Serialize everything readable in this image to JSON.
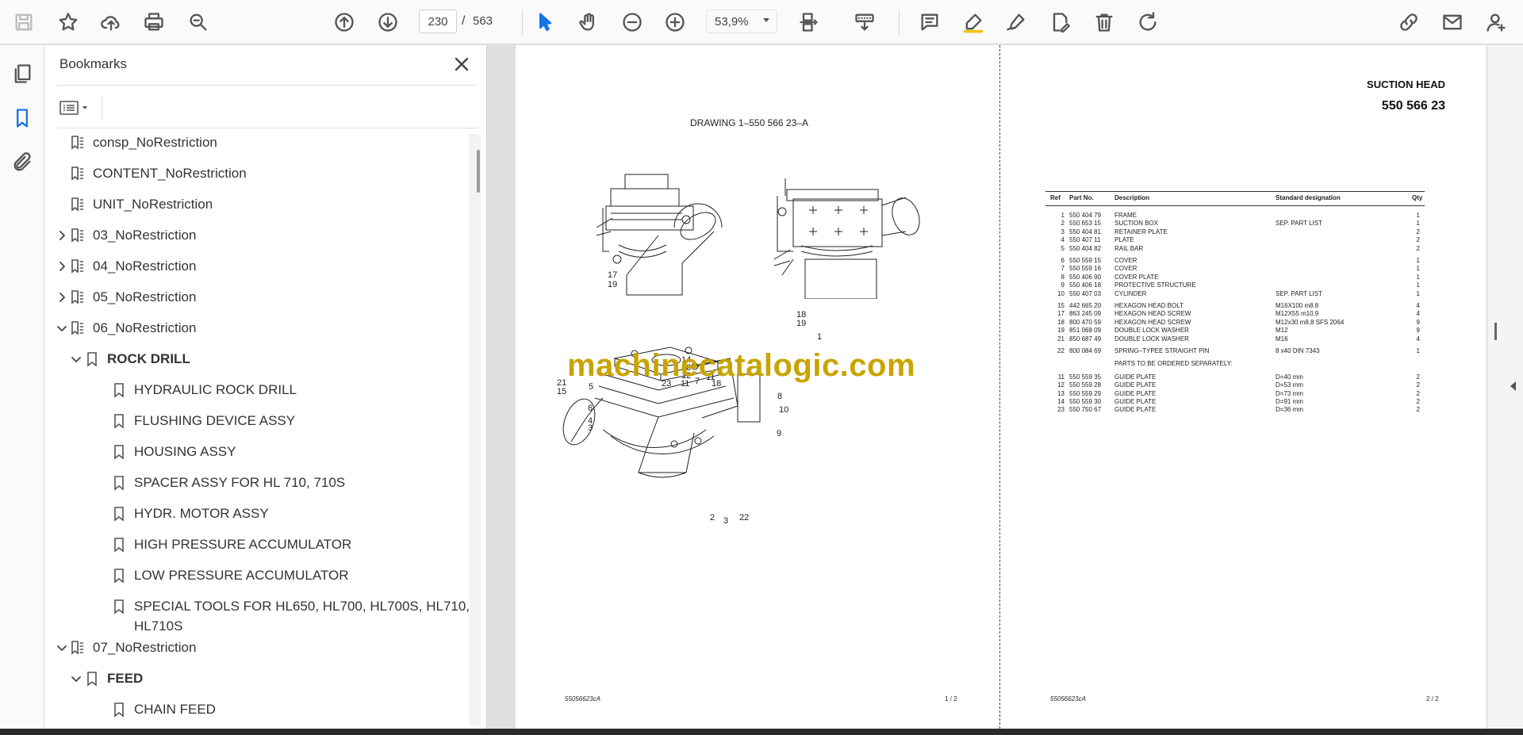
{
  "toolbar": {
    "page_current": "230",
    "page_separator": "/",
    "page_total": "563",
    "zoom": "53,9%"
  },
  "bookmarks_panel": {
    "title": "Bookmarks",
    "items": [
      {
        "label": "consp_NoRestriction",
        "level": 0,
        "expander": "none",
        "icon": "tagged-bookmark-icon"
      },
      {
        "label": "CONTENT_NoRestriction",
        "level": 0,
        "expander": "none",
        "icon": "tagged-bookmark-icon"
      },
      {
        "label": "UNIT_NoRestriction",
        "level": 0,
        "expander": "none",
        "icon": "tagged-bookmark-icon"
      },
      {
        "label": "03_NoRestriction",
        "level": 0,
        "expander": "collapsed",
        "icon": "tagged-bookmark-icon"
      },
      {
        "label": "04_NoRestriction",
        "level": 0,
        "expander": "collapsed",
        "icon": "tagged-bookmark-icon"
      },
      {
        "label": "05_NoRestriction",
        "level": 0,
        "expander": "collapsed",
        "icon": "tagged-bookmark-icon"
      },
      {
        "label": "06_NoRestriction",
        "level": 0,
        "expander": "expanded",
        "icon": "tagged-bookmark-icon"
      },
      {
        "label": "ROCK DRILL",
        "level": 1,
        "expander": "expanded",
        "icon": "bookmark-icon",
        "bold": true
      },
      {
        "label": "HYDRAULIC ROCK DRILL",
        "level": 2,
        "expander": "none",
        "icon": "bookmark-icon"
      },
      {
        "label": "FLUSHING DEVICE ASSY",
        "level": 2,
        "expander": "none",
        "icon": "bookmark-icon"
      },
      {
        "label": "HOUSING ASSY",
        "level": 2,
        "expander": "none",
        "icon": "bookmark-icon"
      },
      {
        "label": "SPACER ASSY FOR HL 710, 710S",
        "level": 2,
        "expander": "none",
        "icon": "bookmark-icon"
      },
      {
        "label": "HYDR. MOTOR ASSY",
        "level": 2,
        "expander": "none",
        "icon": "bookmark-icon"
      },
      {
        "label": "HIGH PRESSURE ACCUMULATOR",
        "level": 2,
        "expander": "none",
        "icon": "bookmark-icon"
      },
      {
        "label": "LOW PRESSURE ACCUMULATOR",
        "level": 2,
        "expander": "none",
        "icon": "bookmark-icon"
      },
      {
        "label": "SPECIAL TOOLS FOR HL650, HL700, HL700S, HL710,",
        "label2": "HL710S",
        "level": 2,
        "expander": "none",
        "icon": "bookmark-icon"
      },
      {
        "label": "07_NoRestriction",
        "level": 0,
        "expander": "expanded",
        "icon": "tagged-bookmark-icon"
      },
      {
        "label": "FEED",
        "level": 1,
        "expander": "expanded",
        "icon": "bookmark-icon",
        "bold": true
      },
      {
        "label": "CHAIN FEED",
        "level": 2,
        "expander": "none",
        "icon": "bookmark-icon"
      }
    ]
  },
  "document": {
    "left_page": {
      "drawing_title": "DRAWING  1–550 566 23–A",
      "footer_code": "55056623cA",
      "footer_page": "1 /  2",
      "callouts": [
        "17",
        "19",
        "18",
        "19",
        "1",
        "14",
        "13",
        "12",
        "7",
        "11",
        "21",
        "5",
        "15",
        "23",
        "11",
        "18",
        "6",
        "4",
        "3",
        "8",
        "10",
        "9",
        "2",
        "3",
        "22"
      ]
    },
    "right_page": {
      "title": "SUCTION HEAD",
      "number": "550 566 23",
      "footer_code": "55056623cA",
      "footer_page": "2 /  2",
      "table": {
        "headers": {
          "ref": "Ref",
          "part": "Part No.",
          "desc": "Description",
          "std": "Standard designation",
          "qty": "Qty"
        },
        "rows": [
          {
            "ref": "1",
            "part": "550 404 79",
            "desc": "FRAME",
            "std": "",
            "qty": "1"
          },
          {
            "ref": "2",
            "part": "550 653 15",
            "desc": "SUCTION BOX",
            "std": "SEP. PART LIST",
            "qty": "1"
          },
          {
            "ref": "3",
            "part": "550 404 81",
            "desc": "RETAINER PLATE",
            "std": "",
            "qty": "2"
          },
          {
            "ref": "4",
            "part": "550 407 11",
            "desc": "PLATE",
            "std": "",
            "qty": "2"
          },
          {
            "ref": "5",
            "part": "550 404 82",
            "desc": "RAIL BAR",
            "std": "",
            "qty": "2"
          },
          {
            "ref": "6",
            "part": "550 559 15",
            "desc": "COVER",
            "std": "",
            "qty": "1"
          },
          {
            "ref": "7",
            "part": "550 559 16",
            "desc": "COVER",
            "std": "",
            "qty": "1"
          },
          {
            "ref": "8",
            "part": "550 406 90",
            "desc": "COVER PLATE",
            "std": "",
            "qty": "1"
          },
          {
            "ref": "9",
            "part": "550 406 18",
            "desc": "PROTECTIVE STRUCTURE",
            "std": "",
            "qty": "1"
          },
          {
            "ref": "10",
            "part": "550 407 03",
            "desc": "CYLINDER",
            "std": "SEP. PART LIST",
            "qty": "1"
          },
          {
            "ref": "15",
            "part": "442 665 20",
            "desc": "HEXAGON HEAD BOLT",
            "std": "M16X100 m8.8",
            "qty": "4"
          },
          {
            "ref": "17",
            "part": "863 245 09",
            "desc": "HEXAGON HEAD SCREW",
            "std": "M12X55 m10,9",
            "qty": "4"
          },
          {
            "ref": "18",
            "part": "800 470 59",
            "desc": "HEXAGON HEAD SCREW",
            "std": "M12x30 m8,8 SFS 2064",
            "qty": "9"
          },
          {
            "ref": "19",
            "part": "851 068 09",
            "desc": "DOUBLE LOCK WASHER",
            "std": "M12",
            "qty": "9"
          },
          {
            "ref": "21",
            "part": "850 687 49",
            "desc": "DOUBLE LOCK WASHER",
            "std": "M16",
            "qty": "4"
          },
          {
            "ref": "22",
            "part": "800 084 69",
            "desc": "SPRING–TYPEE STRAIGHT PIN",
            "std": "8 x40 DIN 7343",
            "qty": "1"
          },
          {
            "ref": "",
            "part": "",
            "desc": "PARTS TO BE ORDERED SEPARATELY:",
            "std": "",
            "qty": ""
          },
          {
            "ref": "11",
            "part": "550 559 35",
            "desc": "GUIDE PLATE",
            "std": "D=40 mm",
            "qty": "2"
          },
          {
            "ref": "12",
            "part": "550 559 28",
            "desc": "GUIDE PLATE",
            "std": "D=53 mm",
            "qty": "2"
          },
          {
            "ref": "13",
            "part": "550 559 29",
            "desc": "GUIDE PLATE",
            "std": "D=73 mm",
            "qty": "2"
          },
          {
            "ref": "14",
            "part": "550 559 30",
            "desc": "GUIDE PLATE",
            "std": "D=91 mm",
            "qty": "2"
          },
          {
            "ref": "23",
            "part": "550 750 67",
            "desc": "GUIDE PLATE",
            "std": "D=36 mm",
            "qty": "2"
          }
        ]
      }
    },
    "watermark": "machinecatalogic.com"
  },
  "colors": {
    "watermark": "#c9a400",
    "accent": "#1a73e8"
  }
}
